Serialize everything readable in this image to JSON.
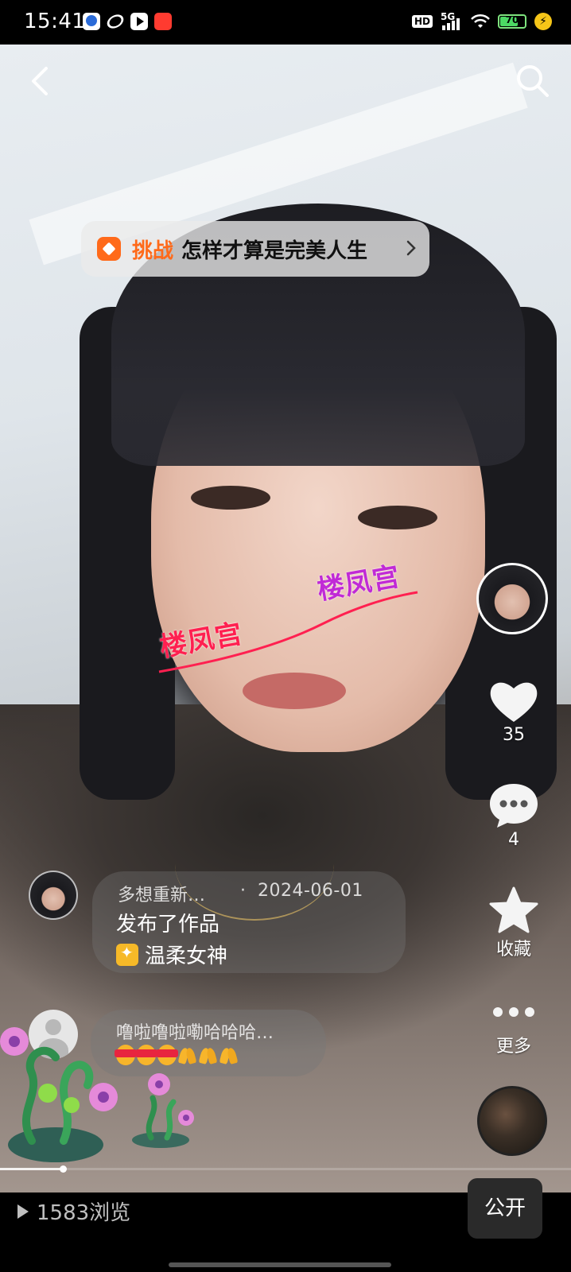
{
  "status_bar": {
    "time": "15:41",
    "hd": "HD",
    "network": "5G",
    "battery_level": "70",
    "app_icons": [
      "baidu-icon",
      "browser-ring-icon",
      "video-play-icon",
      "app-red-icon"
    ]
  },
  "top_nav": {
    "back_icon": "chevron-left-icon",
    "search_icon": "search-icon"
  },
  "challenge": {
    "tag": "挑战",
    "title": "怎样才算是完美人生"
  },
  "watermark": {
    "text_1": "楼凤宫",
    "text_2": "楼凤宫"
  },
  "right_rail": {
    "like_count": "35",
    "comment_count": "4",
    "favorite_label": "收藏",
    "more_label": "更多"
  },
  "post_info": {
    "author": "多想重新…",
    "separator": "·",
    "date": "2024-06-01",
    "action": "发布了作品",
    "tag": "温柔女神"
  },
  "comment": {
    "author": "噜啦噜啦嘞哈哈哈…",
    "emoji_label": "加油",
    "emojis": [
      "jiayou",
      "jiayou",
      "jiayou",
      "pray",
      "pray",
      "pray"
    ]
  },
  "progress": {
    "played_fraction": 0.11
  },
  "bottom_bar": {
    "views": "1583浏览",
    "public_label": "公开"
  },
  "colors": {
    "accent_orange": "#ff6a1a",
    "watermark_red": "#ff2050",
    "watermark_purple": "#c02ad6",
    "battery_green": "#4cd964"
  }
}
